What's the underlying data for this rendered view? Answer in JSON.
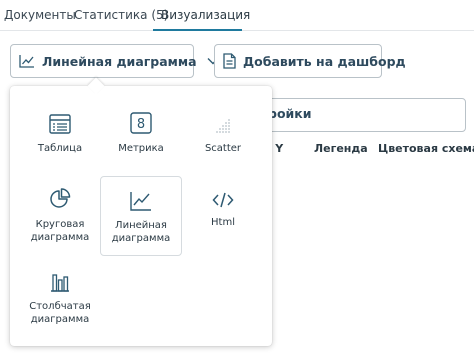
{
  "tabs": [
    {
      "label": "Документы"
    },
    {
      "label": "Статистика (5)"
    },
    {
      "label": "Визуализация"
    }
  ],
  "toolbar": {
    "chart_type_label": "Линейная диаграмма",
    "add_dashboard_label": "Добавить на дашборд"
  },
  "settings": {
    "label_partial": "ройки",
    "columns": [
      "сь Y",
      "Легенда",
      "Цветовая схема"
    ]
  },
  "chart_types": [
    {
      "label": "Таблица",
      "icon": "table-icon"
    },
    {
      "label": "Метрика",
      "icon": "metric-icon"
    },
    {
      "label": "Scatter",
      "icon": "scatter-icon"
    },
    {
      "label": "Круговая диаграмма",
      "icon": "pie-chart-icon"
    },
    {
      "label": "Линейная диаграмма",
      "icon": "line-chart-icon"
    },
    {
      "label": "Html",
      "icon": "code-icon"
    },
    {
      "label": "Столбчатая диаграмма",
      "icon": "bar-chart-icon"
    }
  ],
  "metric_icon_digit": "8",
  "colors": {
    "accent": "#1f7a9e",
    "icon": "#2e5a72",
    "text": "#2b3a44",
    "border": "#b9c2c8"
  }
}
